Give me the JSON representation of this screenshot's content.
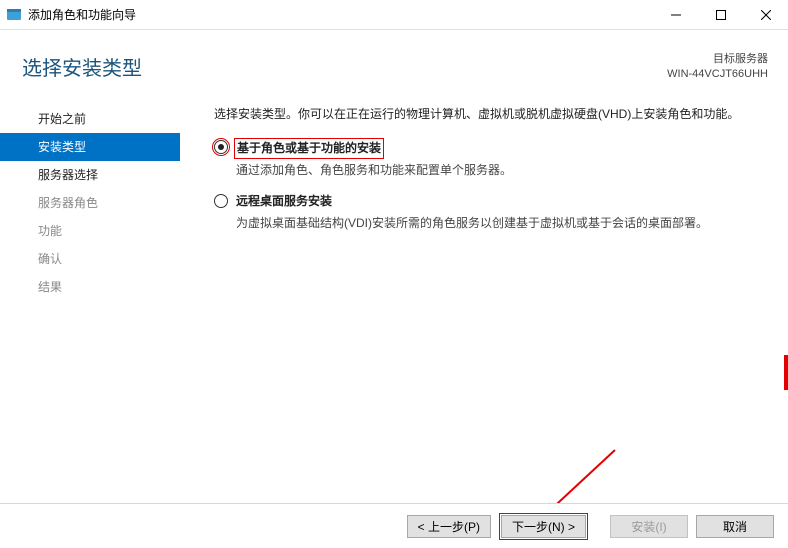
{
  "titlebar": {
    "title": "添加角色和功能向导"
  },
  "header": {
    "heading": "选择安装类型",
    "target_label": "目标服务器",
    "target_value": "WIN-44VCJT66UHH"
  },
  "sidebar": {
    "items": [
      {
        "label": "开始之前",
        "state": "enabled"
      },
      {
        "label": "安装类型",
        "state": "active"
      },
      {
        "label": "服务器选择",
        "state": "enabled"
      },
      {
        "label": "服务器角色",
        "state": "disabled"
      },
      {
        "label": "功能",
        "state": "disabled"
      },
      {
        "label": "确认",
        "state": "disabled"
      },
      {
        "label": "结果",
        "state": "disabled"
      }
    ]
  },
  "content": {
    "intro": "选择安装类型。你可以在正在运行的物理计算机、虚拟机或脱机虚拟硬盘(VHD)上安装角色和功能。",
    "options": [
      {
        "title": "基于角色或基于功能的安装",
        "desc": "通过添加角色、角色服务和功能来配置单个服务器。",
        "selected": true,
        "highlight": true
      },
      {
        "title": "远程桌面服务安装",
        "desc": "为虚拟桌面基础结构(VDI)安装所需的角色服务以创建基于虚拟机或基于会话的桌面部署。",
        "selected": false,
        "highlight": false
      }
    ]
  },
  "footer": {
    "prev": "< 上一步(P)",
    "next": "下一步(N) >",
    "install": "安装(I)",
    "cancel": "取消"
  }
}
